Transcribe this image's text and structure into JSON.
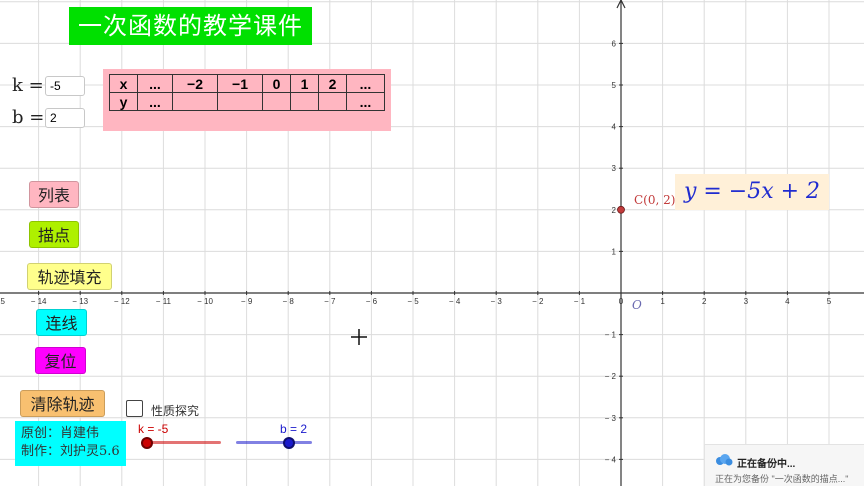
{
  "title": "一次函数的教学课件",
  "params": {
    "k": {
      "label": "k =",
      "value": "-5"
    },
    "b": {
      "label": "b =",
      "value": "2"
    }
  },
  "value_table": {
    "row_x": [
      "x",
      "...",
      "−2",
      "−1",
      "0",
      "1",
      "2",
      "..."
    ],
    "row_y": [
      "y",
      "...",
      "",
      "",
      "",
      "",
      "",
      "..."
    ]
  },
  "buttons": {
    "list": "列表",
    "plot": "描点",
    "trace_fill": "轨迹填充",
    "connect": "连线",
    "reset": "复位",
    "clear_trace": "清除轨迹"
  },
  "checkbox": {
    "label": "性质探究",
    "checked": false
  },
  "credit": {
    "author": "原创：肖建伟",
    "maker": "制作：刘护灵5.6"
  },
  "sliders": {
    "k": {
      "label": "k = -5",
      "value": -5,
      "min": -5,
      "max": 5,
      "color": "#cc0000"
    },
    "b": {
      "label": "b = 2",
      "value": 2,
      "min": -5,
      "max": 5,
      "color": "#1a1acc"
    }
  },
  "equation": "y = −5x + 2",
  "point": {
    "label": "C(0, 2)",
    "x": 0,
    "y": 2
  },
  "origin_label": "O",
  "axes": {
    "x_ticks": [
      "15",
      "14",
      "13",
      "12",
      "11",
      "10",
      "9",
      "8",
      "7",
      "6",
      "5",
      "4",
      "3",
      "2",
      "1",
      "0",
      "1",
      "2",
      "3",
      "4",
      "5"
    ],
    "y_ticks": [
      "6",
      "5",
      "4",
      "3",
      "2",
      "1",
      "1",
      "2",
      "3",
      "4"
    ]
  },
  "notification": {
    "title": "正在备份中...",
    "subtitle": "正在为您备份 \"一次函数的描点...\""
  },
  "colors": {
    "title_bg": "#00e000",
    "table_bg": "#ffb6c1",
    "btn_list": "#ffb6c1",
    "btn_plot": "#aef000",
    "btn_trace_fill": "#ffff8c",
    "btn_connect": "#00ffff",
    "btn_reset": "#ff00ff",
    "btn_clear": "#f8c070",
    "equation": "#1f2bd0",
    "point": "#c23b3b"
  }
}
